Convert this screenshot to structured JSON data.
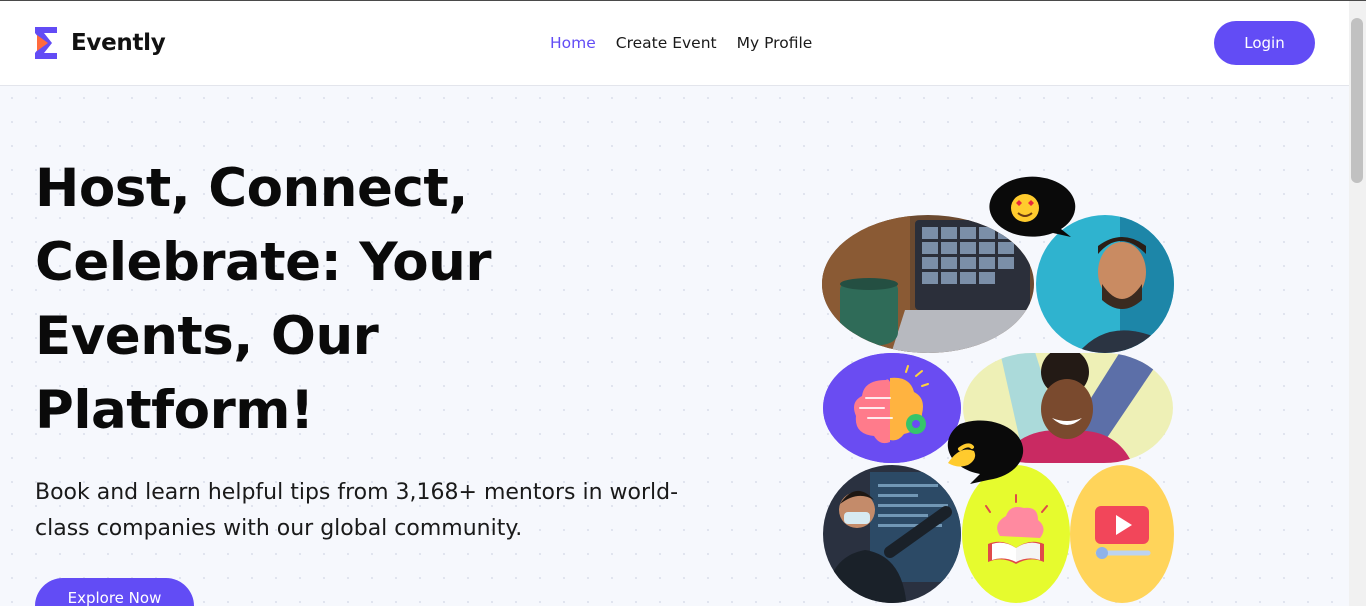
{
  "brand": {
    "name": "Evently",
    "accent": "#624cf5"
  },
  "nav": {
    "items": [
      "Home",
      "Create Event",
      "My Profile"
    ],
    "active": "Home"
  },
  "header": {
    "login_label": "Login"
  },
  "hero": {
    "title": "Host, Connect, Celebrate: Your Events, Our Platform!",
    "subtitle": "Book and learn helpful tips from 3,168+ mentors in world-class companies with our global community.",
    "cta_label": "Explore Now"
  },
  "collage": {
    "tiles": [
      "laptop-video-call-photo",
      "smiling-man-photo",
      "brain-gear-icon",
      "laughing-woman-photo",
      "presenter-photo",
      "brain-book-icon",
      "video-play-icon"
    ],
    "bubbles": [
      "heart-eyes-emoji",
      "pinched-fingers-emoji"
    ],
    "colors": {
      "purple": "#6a4cf2",
      "lime": "#e6fb2e",
      "yellow": "#ffd45a",
      "dark": "#0a0a0a"
    }
  }
}
